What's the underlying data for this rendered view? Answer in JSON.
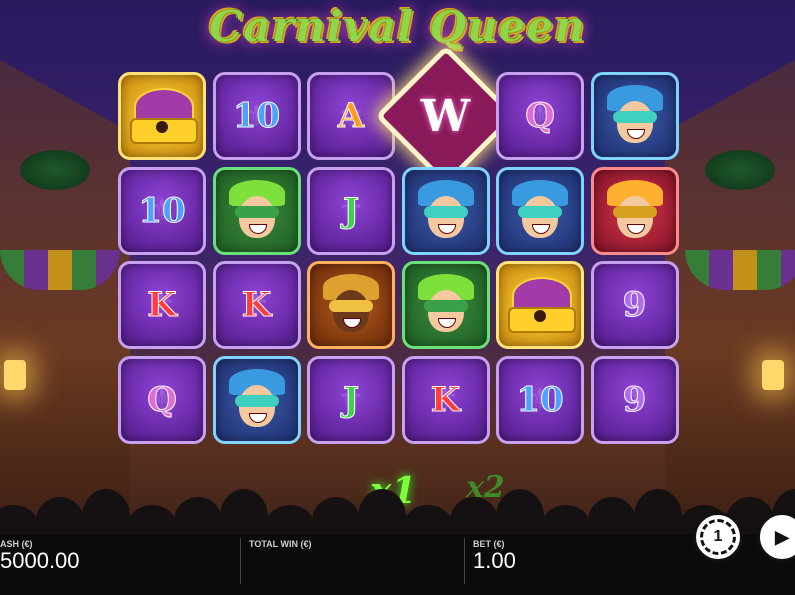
{
  "game": {
    "title": "Carnival Queen"
  },
  "reels": [
    [
      {
        "type": "crown"
      },
      {
        "type": "card",
        "label": "10",
        "cls": "c-10"
      },
      {
        "type": "card",
        "label": "A",
        "cls": "c-A"
      },
      {
        "type": "wild",
        "label": "W"
      },
      {
        "type": "card",
        "label": "Q",
        "cls": "c-Q"
      },
      {
        "type": "face",
        "face": "jester"
      }
    ],
    [
      {
        "type": "card",
        "label": "10",
        "cls": "c-10"
      },
      {
        "type": "face",
        "face": "green-man"
      },
      {
        "type": "card",
        "label": "J",
        "cls": "c-J"
      },
      {
        "type": "face",
        "face": "jester"
      },
      {
        "type": "face",
        "face": "jester"
      },
      {
        "type": "face",
        "face": "red-lady"
      }
    ],
    [
      {
        "type": "card",
        "label": "K",
        "cls": "c-K"
      },
      {
        "type": "card",
        "label": "K",
        "cls": "c-K"
      },
      {
        "type": "face",
        "face": "brown-man"
      },
      {
        "type": "face",
        "face": "green-man"
      },
      {
        "type": "crown"
      },
      {
        "type": "card",
        "label": "9",
        "cls": "c-9"
      }
    ],
    [
      {
        "type": "card",
        "label": "Q",
        "cls": "c-Q"
      },
      {
        "type": "face",
        "face": "jester"
      },
      {
        "type": "card",
        "label": "J",
        "cls": "c-J"
      },
      {
        "type": "card",
        "label": "K",
        "cls": "c-K"
      },
      {
        "type": "card",
        "label": "10",
        "cls": "c-10"
      },
      {
        "type": "card",
        "label": "9",
        "cls": "c-9"
      }
    ]
  ],
  "multipliers": {
    "active": "x1",
    "next": "x2"
  },
  "footer": {
    "cash_label": "ASH (€)",
    "cash_value": "5000.00",
    "total_win_label": "TOTAL WIN (€)",
    "total_win_value": "",
    "bet_label": "BET (€)",
    "bet_value": "1.00"
  },
  "colors": {
    "accent": "#7dff3a",
    "cell_purple": "#6a2aa8"
  },
  "icons": {
    "bet_button": "chip-icon",
    "spin_button": "autoplay-icon"
  }
}
